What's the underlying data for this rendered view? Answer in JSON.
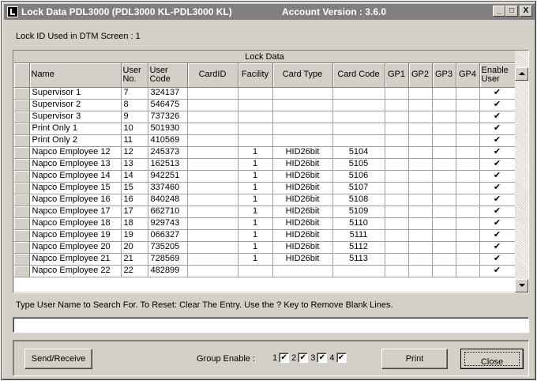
{
  "window": {
    "title": "Lock Data PDL3000 (PDL3000 KL-PDL3000 KL)",
    "version": "Account Version : 3.6.0",
    "minimize_label": "_",
    "maximize_label": "□",
    "close_label": "X"
  },
  "lock_id_label": "Lock ID Used in DTM Screen : 1",
  "grid": {
    "caption": "Lock Data",
    "headers": {
      "name": "Name",
      "user_no": "User No.",
      "user_code": "User Code",
      "card_id": "CardID",
      "facility": "Facility",
      "card_type": "Card Type",
      "card_code": "Card Code",
      "gp1": "GP1",
      "gp2": "GP2",
      "gp3": "GP3",
      "gp4": "GP4",
      "enable_user": "Enable User"
    },
    "rows": [
      {
        "name": "Supervisor 1",
        "user_no": "7",
        "user_code": "324137",
        "card_id": "",
        "facility": "",
        "card_type": "",
        "card_code": "",
        "enable": "✔"
      },
      {
        "name": "Supervisor 2",
        "user_no": "8",
        "user_code": "546475",
        "card_id": "",
        "facility": "",
        "card_type": "",
        "card_code": "",
        "enable": "✔"
      },
      {
        "name": "Supervisor 3",
        "user_no": "9",
        "user_code": "737326",
        "card_id": "",
        "facility": "",
        "card_type": "",
        "card_code": "",
        "enable": "✔"
      },
      {
        "name": "Print Only 1",
        "user_no": "10",
        "user_code": "501930",
        "card_id": "",
        "facility": "",
        "card_type": "",
        "card_code": "",
        "enable": "✔"
      },
      {
        "name": "Print Only 2",
        "user_no": "11",
        "user_code": "410569",
        "card_id": "",
        "facility": "",
        "card_type": "",
        "card_code": "",
        "enable": "✔"
      },
      {
        "name": "Napco Employee 12",
        "user_no": "12",
        "user_code": "245373",
        "card_id": "",
        "facility": "1",
        "card_type": "HID26bit",
        "card_code": "5104",
        "enable": "✔"
      },
      {
        "name": "Napco Employee 13",
        "user_no": "13",
        "user_code": "162513",
        "card_id": "",
        "facility": "1",
        "card_type": "HID26bit",
        "card_code": "5105",
        "enable": "✔"
      },
      {
        "name": "Napco Employee 14",
        "user_no": "14",
        "user_code": "942251",
        "card_id": "",
        "facility": "1",
        "card_type": "HID26bit",
        "card_code": "5106",
        "enable": "✔"
      },
      {
        "name": "Napco Employee 15",
        "user_no": "15",
        "user_code": "337460",
        "card_id": "",
        "facility": "1",
        "card_type": "HID26bit",
        "card_code": "5107",
        "enable": "✔"
      },
      {
        "name": "Napco Employee 16",
        "user_no": "16",
        "user_code": "840248",
        "card_id": "",
        "facility": "1",
        "card_type": "HID26bit",
        "card_code": "5108",
        "enable": "✔"
      },
      {
        "name": "Napco Employee 17",
        "user_no": "17",
        "user_code": "662710",
        "card_id": "",
        "facility": "1",
        "card_type": "HID26bit",
        "card_code": "5109",
        "enable": "✔"
      },
      {
        "name": "Napco Employee 18",
        "user_no": "18",
        "user_code": "929743",
        "card_id": "",
        "facility": "1",
        "card_type": "HID26bit",
        "card_code": "5110",
        "enable": "✔"
      },
      {
        "name": "Napco Employee 19",
        "user_no": "19",
        "user_code": "066327",
        "card_id": "",
        "facility": "1",
        "card_type": "HID26bit",
        "card_code": "5111",
        "enable": "✔"
      },
      {
        "name": "Napco Employee 20",
        "user_no": "20",
        "user_code": "735205",
        "card_id": "",
        "facility": "1",
        "card_type": "HID26bit",
        "card_code": "5112",
        "enable": "✔"
      },
      {
        "name": "Napco Employee 21",
        "user_no": "21",
        "user_code": "728569",
        "card_id": "",
        "facility": "1",
        "card_type": "HID26bit",
        "card_code": "5113",
        "enable": "✔"
      },
      {
        "name": "Napco Employee 22",
        "user_no": "22",
        "user_code": "482899",
        "card_id": "",
        "facility": "",
        "card_type": "",
        "card_code": "",
        "enable": "✔"
      }
    ]
  },
  "hint_text": "Type User Name to Search For. To Reset: Clear The Entry. Use the ? Key to Remove Blank Lines.",
  "search_value": "",
  "footer": {
    "send_receive_label": "Send/Receive",
    "group_enable_label": "Group Enable :",
    "groups": [
      {
        "num": "1",
        "checked": "✔"
      },
      {
        "num": "2",
        "checked": "✔"
      },
      {
        "num": "3",
        "checked": "✔"
      },
      {
        "num": "4",
        "checked": "✔"
      }
    ],
    "print_label": "Print",
    "close_label": "Close"
  },
  "colors": {
    "dialog_face": "#d4d0c8",
    "titlebar_inactive": "#7f7f7f"
  }
}
